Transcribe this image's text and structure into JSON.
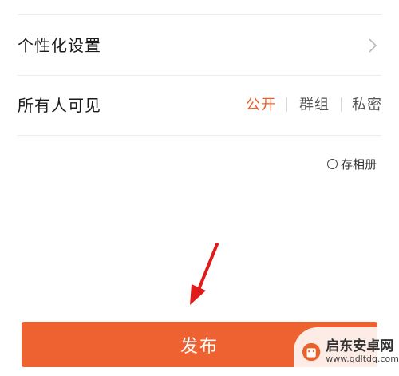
{
  "settings": {
    "personalize": {
      "label": "个性化设置",
      "icon": "chevron-right-icon"
    },
    "visibility": {
      "label": "所有人可见",
      "options": [
        {
          "label": "公开",
          "selected": true
        },
        {
          "label": "群组",
          "selected": false
        },
        {
          "label": "私密",
          "selected": false
        }
      ]
    },
    "save_album": {
      "label": "存相册",
      "checked": false
    }
  },
  "publish_button": {
    "label": "发布"
  },
  "watermark": {
    "name": "启东安卓网",
    "url": "www.qdltdq.com"
  },
  "colors": {
    "accent": "#ee6232",
    "selected_option": "#e8632b",
    "unselected_option": "#555555",
    "arrow": "#e01b1b"
  }
}
